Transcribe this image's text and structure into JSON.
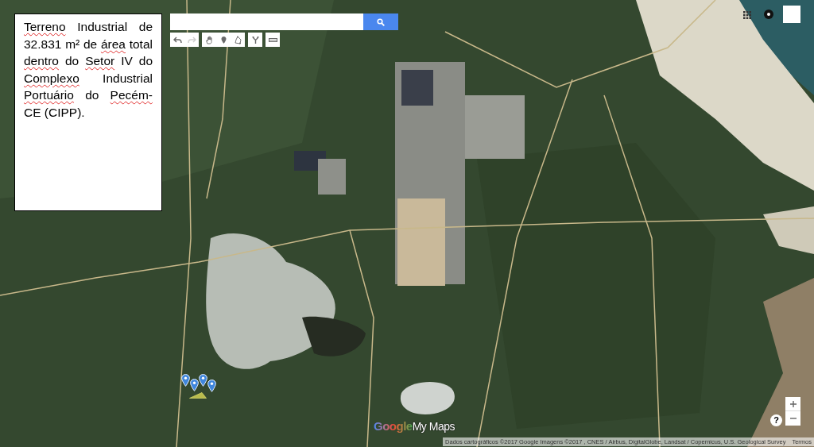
{
  "info_box": {
    "segments": [
      {
        "text": "Terreno",
        "flagged": true
      },
      {
        "text": " Industrial de 32.831 m² de ",
        "flagged": false
      },
      {
        "text": "área",
        "flagged": true
      },
      {
        "text": " total ",
        "flagged": false
      },
      {
        "text": "dentro",
        "flagged": true
      },
      {
        "text": " do ",
        "flagged": false
      },
      {
        "text": "Setor",
        "flagged": true
      },
      {
        "text": " IV do ",
        "flagged": false
      },
      {
        "text": "Complexo",
        "flagged": true
      },
      {
        "text": " Industrial ",
        "flagged": false
      },
      {
        "text": "Portuário",
        "flagged": true
      },
      {
        "text": " do ",
        "flagged": false
      },
      {
        "text": "Pecém-",
        "flagged": true
      },
      {
        "text": "CE (CIPP).",
        "flagged": false
      }
    ]
  },
  "toolbar": {
    "groups": [
      {
        "buttons": [
          {
            "kind": "undo",
            "disabled": false
          },
          {
            "kind": "redo",
            "disabled": true
          }
        ]
      },
      {
        "buttons": [
          {
            "kind": "pan",
            "disabled": false
          },
          {
            "kind": "marker",
            "disabled": false
          },
          {
            "kind": "shape",
            "disabled": false
          }
        ]
      },
      {
        "buttons": [
          {
            "kind": "route",
            "disabled": false
          }
        ]
      },
      {
        "buttons": [
          {
            "kind": "measure",
            "disabled": false
          }
        ]
      }
    ]
  },
  "logo": {
    "wordmark": "Google",
    "product": "My Maps"
  },
  "help_button": "?",
  "attribution": {
    "text": "Dados cartográficos ©2017 Google Imagens ©2017 , CNES / Airbus, DigitalGlobe, Landsat / Copernicus, U.S. Geological Survey",
    "terms_link": "Termos"
  }
}
